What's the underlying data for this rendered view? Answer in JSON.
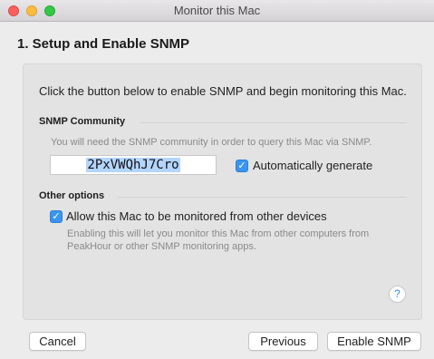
{
  "window": {
    "title": "Monitor this Mac"
  },
  "step": {
    "heading": "1. Setup and Enable SNMP",
    "intro": "Click the button below to enable SNMP and begin monitoring this Mac."
  },
  "community": {
    "section_label": "SNMP Community",
    "hint": "You will need the SNMP community in order to query this Mac via SNMP.",
    "value": "2PxVWQhJ7Cro",
    "auto_generate_label": "Automatically generate",
    "auto_generate_checked": true
  },
  "options": {
    "section_label": "Other options",
    "allow_label": "Allow this Mac to be monitored from other devices",
    "allow_checked": true,
    "description": "Enabling this will let you monitor this Mac from other computers from PeakHour or other SNMP monitoring apps."
  },
  "help_icon": "?",
  "buttons": {
    "cancel": "Cancel",
    "previous": "Previous",
    "enable": "Enable SNMP"
  },
  "colors": {
    "accent": "#3b94f0",
    "selection": "#b4d5fe"
  }
}
